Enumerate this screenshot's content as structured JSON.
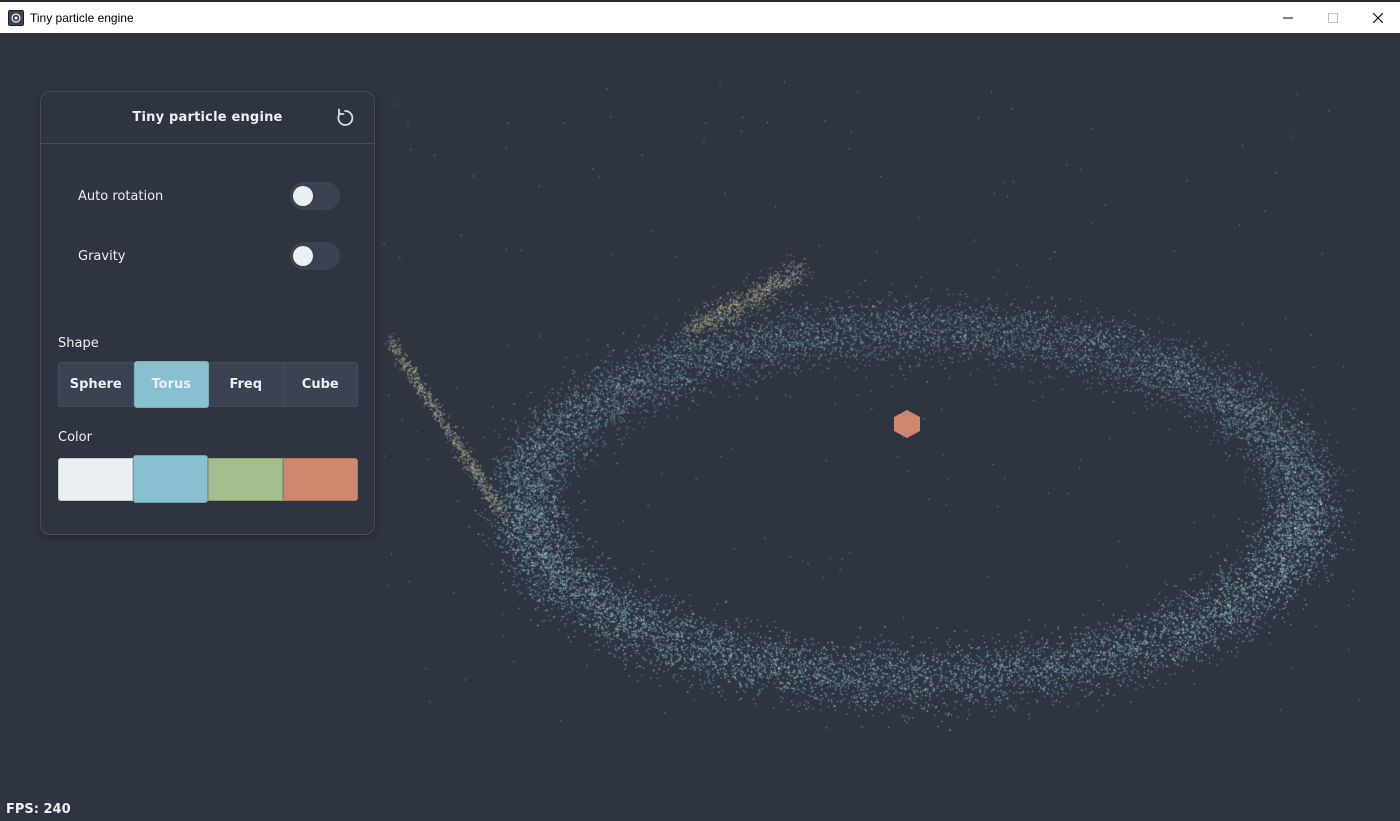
{
  "window": {
    "title": "Tiny particle engine",
    "controls": [
      "minimize",
      "maximize",
      "close"
    ]
  },
  "panel": {
    "title": "Tiny particle engine",
    "reset_icon": "refresh-icon",
    "toggles": [
      {
        "label": "Auto rotation",
        "on": false
      },
      {
        "label": "Gravity",
        "on": false
      }
    ],
    "shape_label": "Shape",
    "shapes": [
      "Sphere",
      "Torus",
      "Freq",
      "Cube"
    ],
    "selected_shape": "Torus",
    "color_label": "Color",
    "colors": [
      "#eceff4",
      "#88c0d0",
      "#a3be8c",
      "#d08770"
    ],
    "selected_color": "#88c0d0"
  },
  "status": {
    "fps": "FPS: 240"
  },
  "scene": {
    "background": "#2e3440",
    "particle_color": "#88c0d0",
    "trail_color": "#ebcb8b",
    "object_color": "#d08770"
  }
}
